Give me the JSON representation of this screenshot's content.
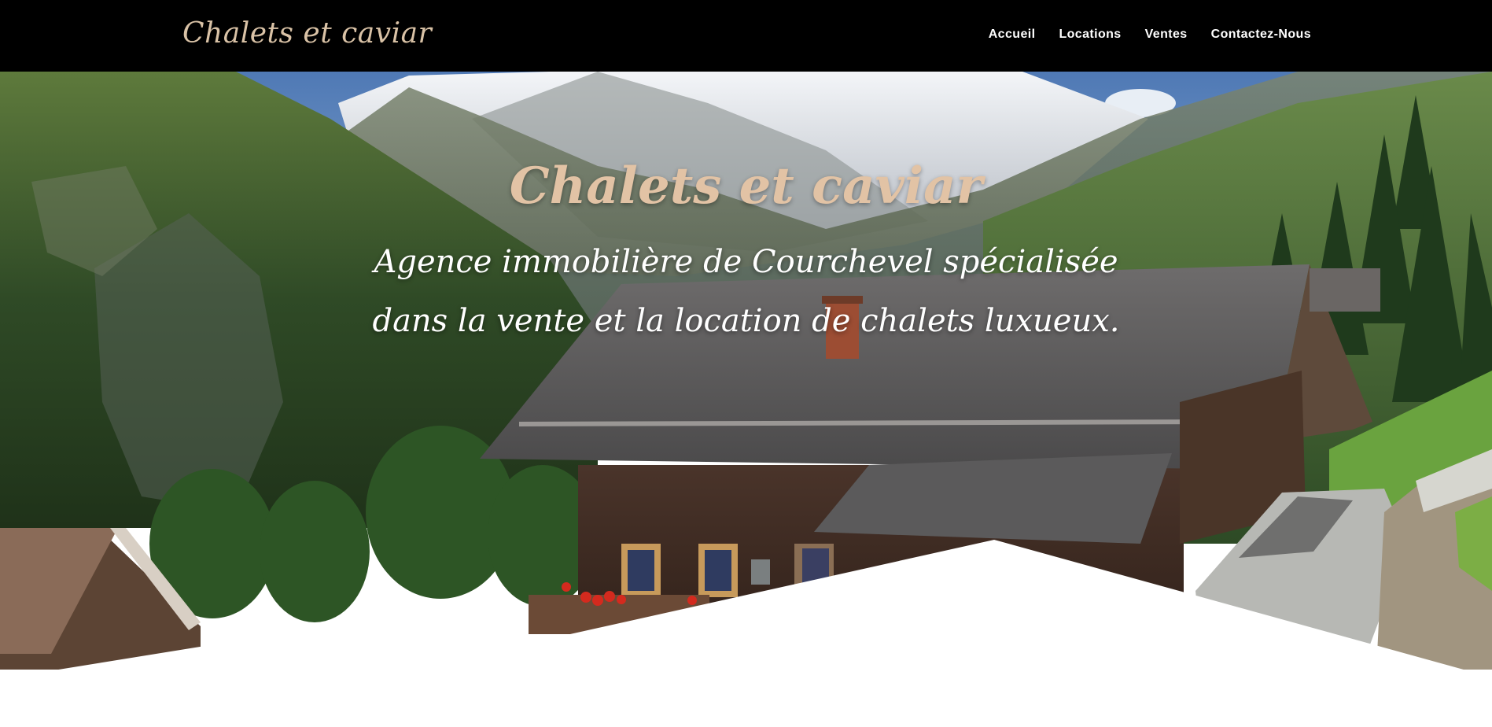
{
  "header": {
    "logo_text": "Chalets et caviar",
    "nav": [
      {
        "label": "Accueil"
      },
      {
        "label": "Locations"
      },
      {
        "label": "Ventes"
      },
      {
        "label": "Contactez-Nous"
      }
    ]
  },
  "hero": {
    "title": "Chalets et caviar",
    "subtitle": "Agence immobilière de Courchevel spécialisée dans la vente et la location de chalets luxueux.",
    "background_image": "alpine-chalet-mountain-photo"
  },
  "colors": {
    "header_bg": "#000000",
    "logo_color": "#d9c2a6",
    "title_color": "#e2c3a5",
    "nav_text": "#ffffff"
  }
}
